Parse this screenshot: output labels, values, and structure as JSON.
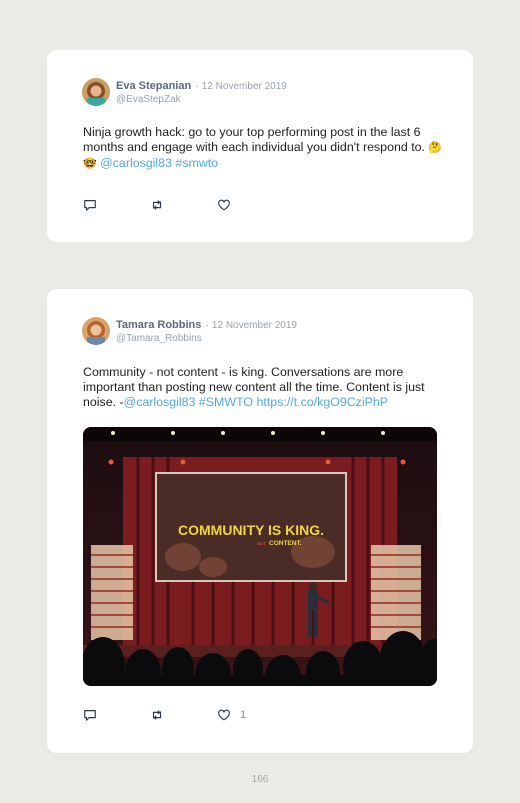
{
  "tweets": [
    {
      "name": "Eva Stepanian",
      "date": "· 12 November 2019",
      "handle": "@EvaStepZak",
      "text": "Ninja growth hack: go to your top performing post in the last 6 months and engage with each individual you didn't respond to.",
      "emoji": "🤔🤓",
      "mention": "@carlosgil83",
      "hashtag": "#smwto",
      "likes": ""
    },
    {
      "name": "Tamara Robbins",
      "date": "· 12 November 2019",
      "handle": "@Tamara_Robbins",
      "text": "Community - not content - is king. Conversations are more important than posting new content all the time. Content is just noise. -",
      "mention": "@carlosgil83",
      "hashtag": "#SMWTO",
      "url": "https://t.co/kgO9CziPhP",
      "likes": "1",
      "photo": {
        "screen_line1": "COMMUNITY IS KING.",
        "screen_small": "NOT",
        "screen_line2": "CONTENT."
      }
    }
  ],
  "page_number": "166",
  "colors": {
    "link": "#52a8e0",
    "background": "#e9ebe6",
    "name": "#5b6b7b"
  }
}
